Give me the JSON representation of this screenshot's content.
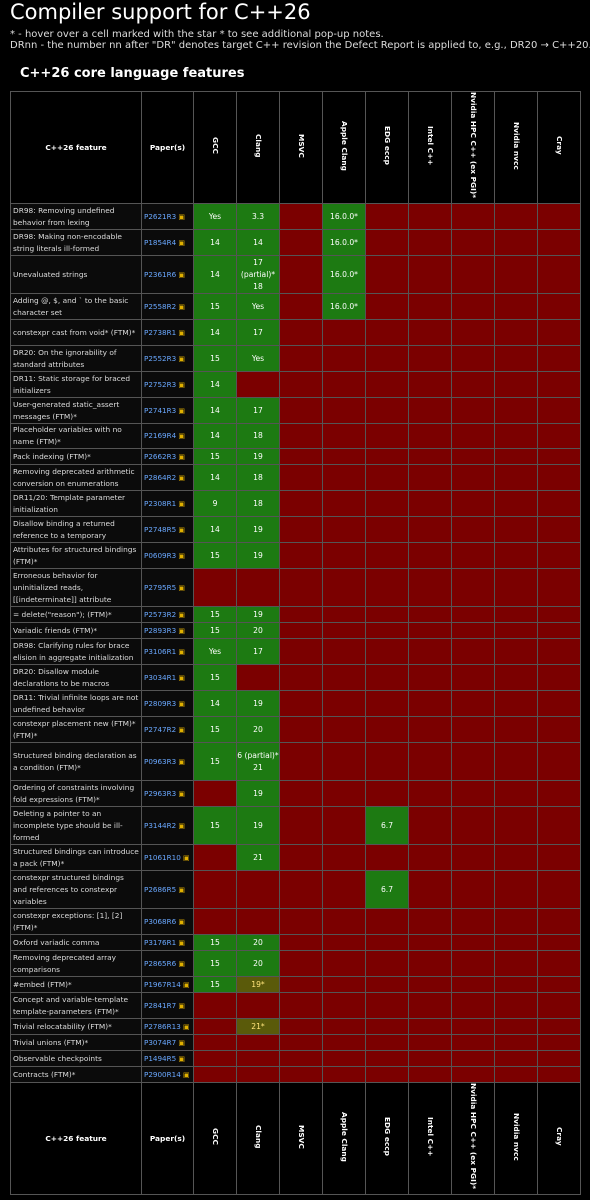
{
  "page": {
    "title": "Compiler support for C++26",
    "note1": "* - hover over a cell marked with the star * to see additional pop-up notes.",
    "note2": "DRnn - the number nn after \"DR\" denotes target C++ revision the Defect Report is applied to, e.g., DR20 → C++20.",
    "section": "C++26 core language features"
  },
  "colors": {
    "unsupported": "#7b0000",
    "supported": "#1d7a12",
    "partial": "#5a5a0a",
    "link": "#6aa8ff"
  },
  "table": {
    "feature_header": "C++26 feature",
    "paper_header": "Paper(s)",
    "compilers": [
      "GCC",
      "Clang",
      "MSVC",
      "Apple Clang",
      "EDG eccp",
      "Intel C++",
      "Nvidia HPC C++ (ex PGI)*",
      "Nvidia nvcc",
      "Cray"
    ],
    "rows": [
      {
        "feature": "DR98: Removing undefined behavior from lexing",
        "paper": "P2621R3",
        "cells": [
          "Yes",
          "3.3",
          "",
          "16.0.0*",
          "",
          "",
          "",
          "",
          ""
        ],
        "support": [
          "y",
          "y",
          "n",
          "y",
          "n",
          "n",
          "n",
          "n",
          "n"
        ]
      },
      {
        "feature": "DR98: Making non-encodable string literals ill-formed",
        "paper": "P1854R4",
        "cells": [
          "14",
          "14",
          "",
          "16.0.0*",
          "",
          "",
          "",
          "",
          ""
        ],
        "support": [
          "y",
          "y",
          "n",
          "y",
          "n",
          "n",
          "n",
          "n",
          "n"
        ]
      },
      {
        "feature": "Unevaluated strings",
        "paper": "P2361R6",
        "cells": [
          "14",
          "17 (partial)* 18",
          "",
          "16.0.0*",
          "",
          "",
          "",
          "",
          ""
        ],
        "support": [
          "y",
          "y",
          "n",
          "y",
          "n",
          "n",
          "n",
          "n",
          "n"
        ]
      },
      {
        "feature": "Adding @, $, and ` to the basic character set",
        "paper": "P2558R2",
        "cells": [
          "15",
          "Yes",
          "",
          "16.0.0*",
          "",
          "",
          "",
          "",
          ""
        ],
        "support": [
          "y",
          "y",
          "n",
          "y",
          "n",
          "n",
          "n",
          "n",
          "n"
        ]
      },
      {
        "feature": "constexpr cast from void* (FTM)*",
        "paper": "P2738R1",
        "cells": [
          "14",
          "17",
          "",
          "",
          "",
          "",
          "",
          "",
          ""
        ],
        "support": [
          "y",
          "y",
          "n",
          "n",
          "n",
          "n",
          "n",
          "n",
          "n"
        ]
      },
      {
        "feature": "DR20: On the ignorability of standard attributes",
        "paper": "P2552R3",
        "cells": [
          "15",
          "Yes",
          "",
          "",
          "",
          "",
          "",
          "",
          ""
        ],
        "support": [
          "y",
          "y",
          "n",
          "n",
          "n",
          "n",
          "n",
          "n",
          "n"
        ]
      },
      {
        "feature": "DR11: Static storage for braced initializers",
        "paper": "P2752R3",
        "cells": [
          "14",
          "",
          "",
          "",
          "",
          "",
          "",
          "",
          ""
        ],
        "support": [
          "y",
          "n",
          "n",
          "n",
          "n",
          "n",
          "n",
          "n",
          "n"
        ]
      },
      {
        "feature": "User-generated static_assert messages (FTM)*",
        "paper": "P2741R3",
        "cells": [
          "14",
          "17",
          "",
          "",
          "",
          "",
          "",
          "",
          ""
        ],
        "support": [
          "y",
          "y",
          "n",
          "n",
          "n",
          "n",
          "n",
          "n",
          "n"
        ]
      },
      {
        "feature": "Placeholder variables with no name (FTM)*",
        "paper": "P2169R4",
        "cells": [
          "14",
          "18",
          "",
          "",
          "",
          "",
          "",
          "",
          ""
        ],
        "support": [
          "y",
          "y",
          "n",
          "n",
          "n",
          "n",
          "n",
          "n",
          "n"
        ]
      },
      {
        "feature": "Pack indexing (FTM)*",
        "paper": "P2662R3",
        "cells": [
          "15",
          "19",
          "",
          "",
          "",
          "",
          "",
          "",
          ""
        ],
        "support": [
          "y",
          "y",
          "n",
          "n",
          "n",
          "n",
          "n",
          "n",
          "n"
        ]
      },
      {
        "feature": "Removing deprecated arithmetic conversion on enumerations",
        "paper": "P2864R2",
        "cells": [
          "14",
          "18",
          "",
          "",
          "",
          "",
          "",
          "",
          ""
        ],
        "support": [
          "y",
          "y",
          "n",
          "n",
          "n",
          "n",
          "n",
          "n",
          "n"
        ]
      },
      {
        "feature": "DR11/20: Template parameter initialization",
        "paper": "P2308R1",
        "cells": [
          "9",
          "18",
          "",
          "",
          "",
          "",
          "",
          "",
          ""
        ],
        "support": [
          "y",
          "y",
          "n",
          "n",
          "n",
          "n",
          "n",
          "n",
          "n"
        ]
      },
      {
        "feature": "Disallow binding a returned reference to a temporary",
        "paper": "P2748R5",
        "cells": [
          "14",
          "19",
          "",
          "",
          "",
          "",
          "",
          "",
          ""
        ],
        "support": [
          "y",
          "y",
          "n",
          "n",
          "n",
          "n",
          "n",
          "n",
          "n"
        ]
      },
      {
        "feature": "Attributes for structured bindings (FTM)*",
        "paper": "P0609R3",
        "cells": [
          "15",
          "19",
          "",
          "",
          "",
          "",
          "",
          "",
          ""
        ],
        "support": [
          "y",
          "y",
          "n",
          "n",
          "n",
          "n",
          "n",
          "n",
          "n"
        ]
      },
      {
        "feature": "Erroneous behavior for uninitialized reads, [[indeterminate]] attribute",
        "paper": "P2795R5",
        "cells": [
          "",
          "",
          "",
          "",
          "",
          "",
          "",
          "",
          ""
        ],
        "support": [
          "n",
          "n",
          "n",
          "n",
          "n",
          "n",
          "n",
          "n",
          "n"
        ]
      },
      {
        "feature": "= delete(\"reason\"); (FTM)*",
        "paper": "P2573R2",
        "cells": [
          "15",
          "19",
          "",
          "",
          "",
          "",
          "",
          "",
          ""
        ],
        "support": [
          "y",
          "y",
          "n",
          "n",
          "n",
          "n",
          "n",
          "n",
          "n"
        ]
      },
      {
        "feature": "Variadic friends (FTM)*",
        "paper": "P2893R3",
        "cells": [
          "15",
          "20",
          "",
          "",
          "",
          "",
          "",
          "",
          ""
        ],
        "support": [
          "y",
          "y",
          "n",
          "n",
          "n",
          "n",
          "n",
          "n",
          "n"
        ]
      },
      {
        "feature": "DR98: Clarifying rules for brace elision in aggregate initialization",
        "paper": "P3106R1",
        "cells": [
          "Yes",
          "17",
          "",
          "",
          "",
          "",
          "",
          "",
          ""
        ],
        "support": [
          "y",
          "y",
          "n",
          "n",
          "n",
          "n",
          "n",
          "n",
          "n"
        ]
      },
      {
        "feature": "DR20: Disallow module declarations to be macros",
        "paper": "P3034R1",
        "cells": [
          "15",
          "",
          "",
          "",
          "",
          "",
          "",
          "",
          ""
        ],
        "support": [
          "y",
          "n",
          "n",
          "n",
          "n",
          "n",
          "n",
          "n",
          "n"
        ]
      },
      {
        "feature": "DR11: Trivial infinite loops are not undefined behavior",
        "paper": "P2809R3",
        "cells": [
          "14",
          "19",
          "",
          "",
          "",
          "",
          "",
          "",
          ""
        ],
        "support": [
          "y",
          "y",
          "n",
          "n",
          "n",
          "n",
          "n",
          "n",
          "n"
        ]
      },
      {
        "feature": "constexpr placement new (FTM)* (FTM)*",
        "paper": "P2747R2",
        "cells": [
          "15",
          "20",
          "",
          "",
          "",
          "",
          "",
          "",
          ""
        ],
        "support": [
          "y",
          "y",
          "n",
          "n",
          "n",
          "n",
          "n",
          "n",
          "n"
        ]
      },
      {
        "feature": "Structured binding declaration as a condition (FTM)*",
        "paper": "P0963R3",
        "cells": [
          "15",
          "6 (partial)* 21",
          "",
          "",
          "",
          "",
          "",
          "",
          ""
        ],
        "support": [
          "y",
          "y",
          "n",
          "n",
          "n",
          "n",
          "n",
          "n",
          "n"
        ]
      },
      {
        "feature": "Ordering of constraints involving fold expressions (FTM)*",
        "paper": "P2963R3",
        "cells": [
          "",
          "19",
          "",
          "",
          "",
          "",
          "",
          "",
          ""
        ],
        "support": [
          "n",
          "y",
          "n",
          "n",
          "n",
          "n",
          "n",
          "n",
          "n"
        ]
      },
      {
        "feature": "Deleting a pointer to an incomplete type should be ill-formed",
        "paper": "P3144R2",
        "cells": [
          "15",
          "19",
          "",
          "",
          "6.7",
          "",
          "",
          "",
          ""
        ],
        "support": [
          "y",
          "y",
          "n",
          "n",
          "y",
          "n",
          "n",
          "n",
          "n"
        ]
      },
      {
        "feature": "Structured bindings can introduce a pack (FTM)*",
        "paper": "P1061R10",
        "cells": [
          "",
          "21",
          "",
          "",
          "",
          "",
          "",
          "",
          ""
        ],
        "support": [
          "n",
          "y",
          "n",
          "n",
          "n",
          "n",
          "n",
          "n",
          "n"
        ]
      },
      {
        "feature": "constexpr structured bindings and references to constexpr variables",
        "paper": "P2686R5",
        "cells": [
          "",
          "",
          "",
          "",
          "6.7",
          "",
          "",
          "",
          ""
        ],
        "support": [
          "n",
          "n",
          "n",
          "n",
          "y",
          "n",
          "n",
          "n",
          "n"
        ]
      },
      {
        "feature": "constexpr exceptions: [1], [2] (FTM)*",
        "paper": "P3068R6",
        "cells": [
          "",
          "",
          "",
          "",
          "",
          "",
          "",
          "",
          ""
        ],
        "support": [
          "n",
          "n",
          "n",
          "n",
          "n",
          "n",
          "n",
          "n",
          "n"
        ]
      },
      {
        "feature": "Oxford variadic comma",
        "paper": "P3176R1",
        "cells": [
          "15",
          "20",
          "",
          "",
          "",
          "",
          "",
          "",
          ""
        ],
        "support": [
          "y",
          "y",
          "n",
          "n",
          "n",
          "n",
          "n",
          "n",
          "n"
        ]
      },
      {
        "feature": "Removing deprecated array comparisons",
        "paper": "P2865R6",
        "cells": [
          "15",
          "20",
          "",
          "",
          "",
          "",
          "",
          "",
          ""
        ],
        "support": [
          "y",
          "y",
          "n",
          "n",
          "n",
          "n",
          "n",
          "n",
          "n"
        ]
      },
      {
        "feature": "#embed (FTM)*",
        "paper": "P1967R14",
        "cells": [
          "15",
          "19*",
          "",
          "",
          "",
          "",
          "",
          "",
          ""
        ],
        "support": [
          "y",
          "p",
          "n",
          "n",
          "n",
          "n",
          "n",
          "n",
          "n"
        ]
      },
      {
        "feature": "Concept and variable-template template-parameters (FTM)*",
        "paper": "P2841R7",
        "cells": [
          "",
          "",
          "",
          "",
          "",
          "",
          "",
          "",
          ""
        ],
        "support": [
          "n",
          "n",
          "n",
          "n",
          "n",
          "n",
          "n",
          "n",
          "n"
        ]
      },
      {
        "feature": "Trivial relocatability (FTM)*",
        "paper": "P2786R13",
        "cells": [
          "",
          "21*",
          "",
          "",
          "",
          "",
          "",
          "",
          ""
        ],
        "support": [
          "n",
          "p",
          "n",
          "n",
          "n",
          "n",
          "n",
          "n",
          "n"
        ]
      },
      {
        "feature": "Trivial unions (FTM)*",
        "paper": "P3074R7",
        "cells": [
          "",
          "",
          "",
          "",
          "",
          "",
          "",
          "",
          ""
        ],
        "support": [
          "n",
          "n",
          "n",
          "n",
          "n",
          "n",
          "n",
          "n",
          "n"
        ]
      },
      {
        "feature": "Observable checkpoints",
        "paper": "P1494R5",
        "cells": [
          "",
          "",
          "",
          "",
          "",
          "",
          "",
          "",
          ""
        ],
        "support": [
          "n",
          "n",
          "n",
          "n",
          "n",
          "n",
          "n",
          "n",
          "n"
        ]
      },
      {
        "feature": "Contracts (FTM)*",
        "paper": "P2900R14",
        "cells": [
          "",
          "",
          "",
          "",
          "",
          "",
          "",
          "",
          ""
        ],
        "support": [
          "n",
          "n",
          "n",
          "n",
          "n",
          "n",
          "n",
          "n",
          "n"
        ]
      }
    ]
  }
}
